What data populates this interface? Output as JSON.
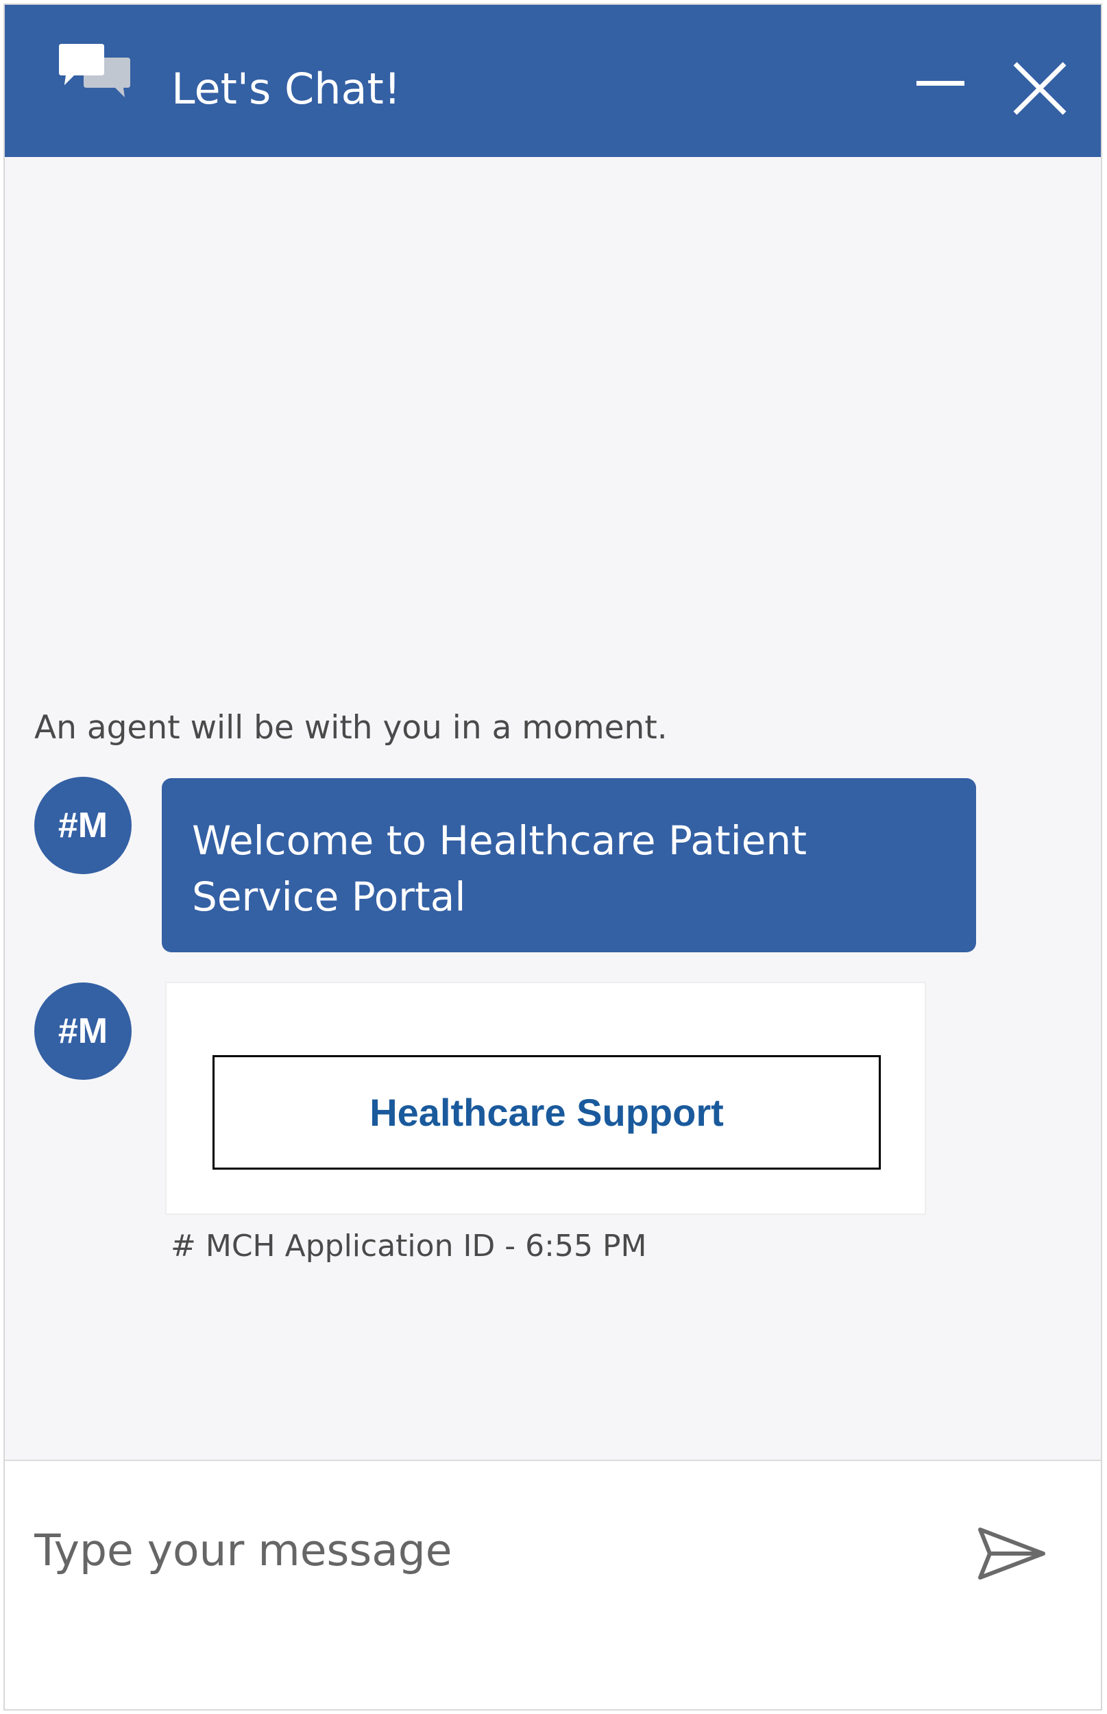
{
  "header": {
    "title": "Let's Chat!",
    "chat_icon": "chat-bubbles-icon",
    "minimize_icon": "minimize-icon",
    "close_icon": "close-icon",
    "background_color": "#3460a4"
  },
  "messages": {
    "system_note": "An agent will be with you in a moment.",
    "items": [
      {
        "avatar": "#M",
        "text": "Welcome to Healthcare Patient Service Portal"
      },
      {
        "avatar": "#M",
        "button_label": "Healthcare Support",
        "meta": "# MCH Application ID - 6:55 PM"
      }
    ]
  },
  "composer": {
    "placeholder": "Type your message",
    "send_icon": "send-icon"
  }
}
